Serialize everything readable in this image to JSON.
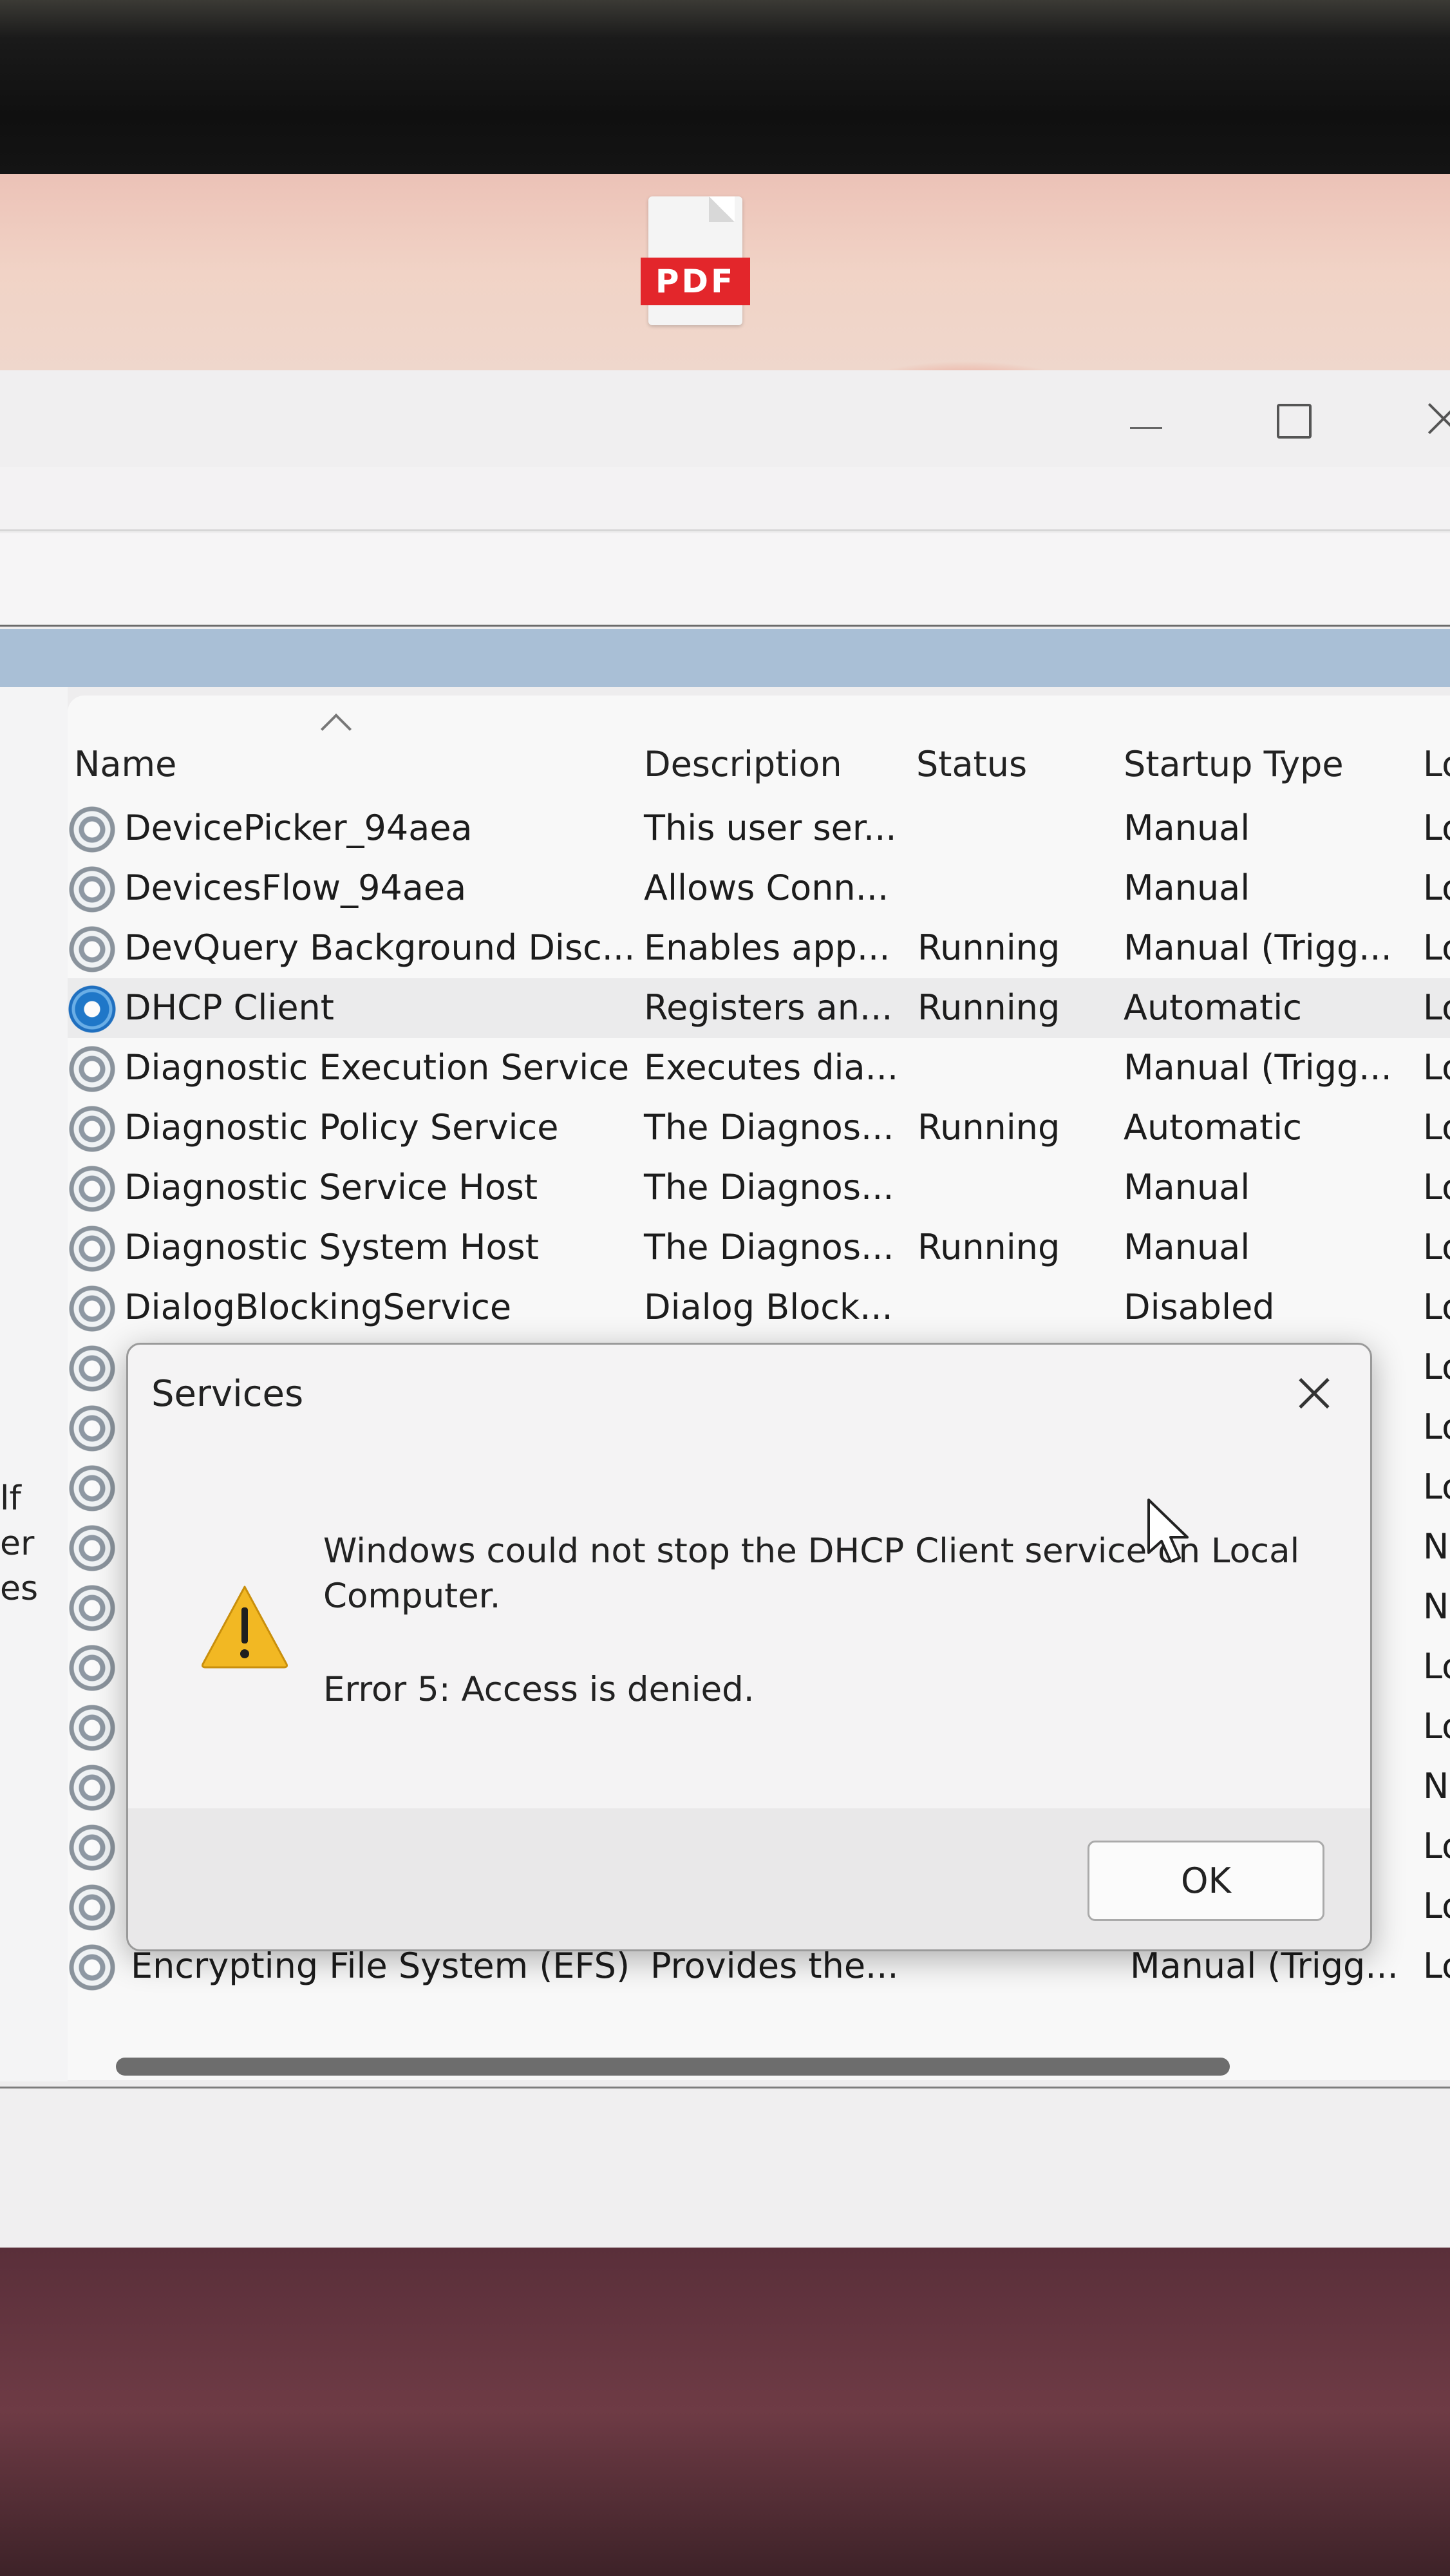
{
  "desktop": {
    "file_icon_label": "PDF"
  },
  "services_list": {
    "columns": {
      "name": "Name",
      "description": "Description",
      "status": "Status",
      "startup_type": "Startup Type",
      "log_on_as": "Lo"
    },
    "left_pane_text": [
      "lf",
      "er",
      "es"
    ],
    "rows": [
      {
        "name": "DevicePicker_94aea",
        "description": "This user ser...",
        "status": "",
        "startup": "Manual",
        "logon": "Lo"
      },
      {
        "name": "DevicesFlow_94aea",
        "description": "Allows Conn...",
        "status": "",
        "startup": "Manual",
        "logon": "Lo"
      },
      {
        "name": "DevQuery Background Disc...",
        "description": "Enables app...",
        "status": "Running",
        "startup": "Manual (Trigg...",
        "logon": "Lo"
      },
      {
        "name": "DHCP Client",
        "description": "Registers an...",
        "status": "Running",
        "startup": "Automatic",
        "logon": "Lo"
      },
      {
        "name": "Diagnostic Execution Service",
        "description": "Executes dia...",
        "status": "",
        "startup": "Manual (Trigg...",
        "logon": "Lo"
      },
      {
        "name": "Diagnostic Policy Service",
        "description": "The Diagnos...",
        "status": "Running",
        "startup": "Automatic",
        "logon": "Lo"
      },
      {
        "name": "Diagnostic Service Host",
        "description": "The Diagnos...",
        "status": "",
        "startup": "Manual",
        "logon": "Lo"
      },
      {
        "name": "Diagnostic System Host",
        "description": "The Diagnos...",
        "status": "Running",
        "startup": "Manual",
        "logon": "Lo"
      },
      {
        "name": "DialogBlockingService",
        "description": "Dialog Block...",
        "status": "",
        "startup": "Disabled",
        "logon": "Lo"
      }
    ],
    "hidden_row_logon": [
      "Lo",
      "Lo",
      "Lo",
      "N",
      "N",
      "Lo",
      "Lo",
      "N",
      "Lo",
      "Lo"
    ],
    "last_row": {
      "name": "Encrypting File System (EFS)",
      "description": "Provides the...",
      "status": "",
      "startup": "Manual (Trigg...",
      "logon": "Lo"
    },
    "selected_row": "DHCP Client"
  },
  "dialog": {
    "title": "Services",
    "message_line1": "Windows could not stop the DHCP Client service on Local",
    "message_line2": "Computer.",
    "error": "Error 5: Access is denied.",
    "ok_label": "OK"
  },
  "colors": {
    "selection": "#ebebec",
    "warning": "#f2b823",
    "service_icon_selected": "#1f77c8"
  }
}
